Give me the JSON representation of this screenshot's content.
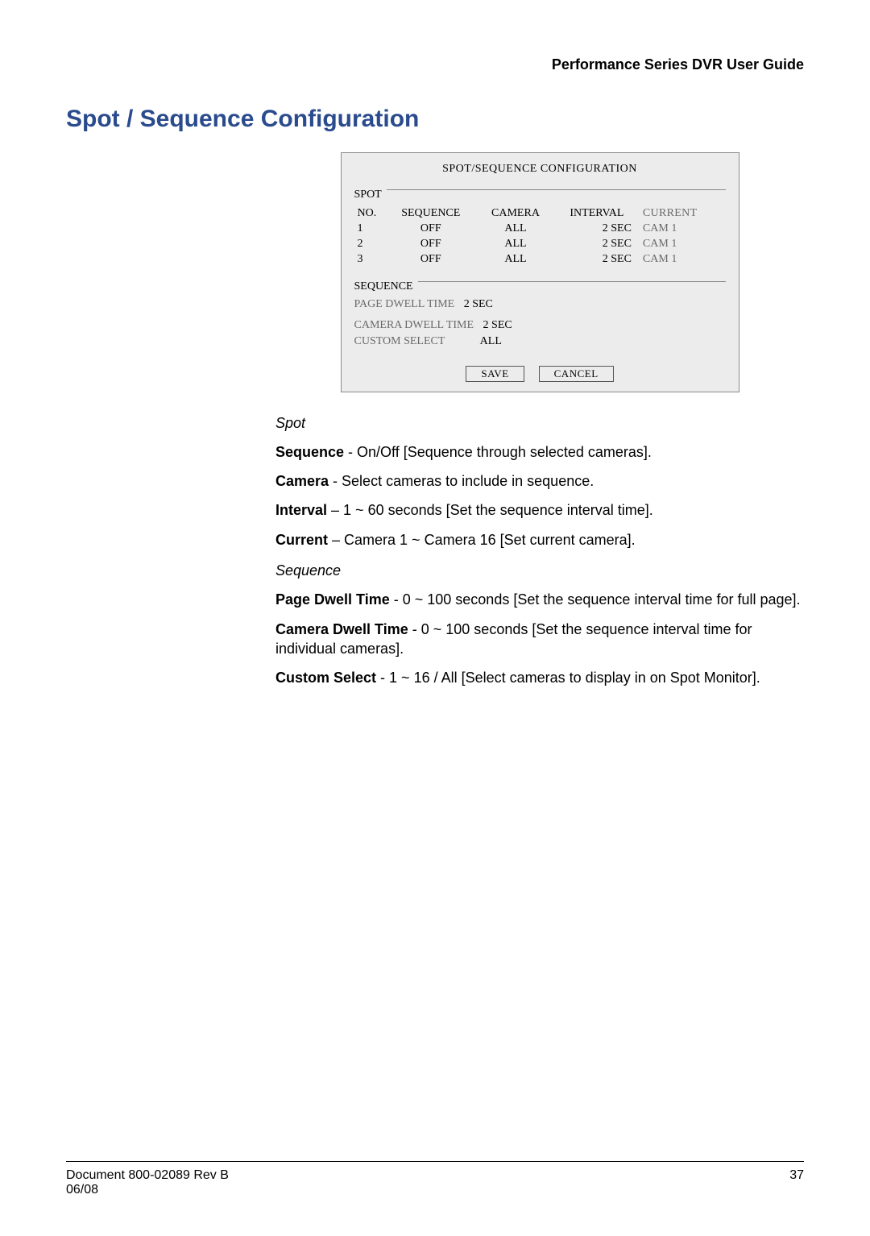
{
  "header": {
    "guide_title": "Performance Series DVR User Guide"
  },
  "section": {
    "heading": "Spot / Sequence Configuration"
  },
  "osd": {
    "title": "SPOT/SEQUENCE CONFIGURATION",
    "spot": {
      "label": "SPOT",
      "headers": {
        "no": "NO.",
        "sequence": "SEQUENCE",
        "camera": "CAMERA",
        "interval": "INTERVAL",
        "current": "CURRENT"
      },
      "rows": [
        {
          "no": "1",
          "sequence": "OFF",
          "camera": "ALL",
          "interval": "2 SEC",
          "current": "CAM 1"
        },
        {
          "no": "2",
          "sequence": "OFF",
          "camera": "ALL",
          "interval": "2 SEC",
          "current": "CAM 1"
        },
        {
          "no": "3",
          "sequence": "OFF",
          "camera": "ALL",
          "interval": "2 SEC",
          "current": "CAM 1"
        }
      ]
    },
    "sequence": {
      "label": "SEQUENCE",
      "page_dwell_label": "PAGE DWELL TIME",
      "page_dwell_value": "2 SEC",
      "camera_dwell_label": "CAMERA DWELL TIME",
      "camera_dwell_value": "2 SEC",
      "custom_select_label": "CUSTOM SELECT",
      "custom_select_value": "ALL"
    },
    "buttons": {
      "save": "SAVE",
      "cancel": "CANCEL"
    }
  },
  "spot_sub": "Spot",
  "spot_items": {
    "sequence": {
      "label": "Sequence",
      "text": " - On/Off [Sequence through selected cameras]."
    },
    "camera": {
      "label": "Camera",
      "text": " - Select cameras to include in sequence."
    },
    "interval": {
      "label": "Interval",
      "text": " – 1 ~ 60 seconds [Set the sequence interval time]."
    },
    "current": {
      "label": "Current",
      "text": " – Camera 1 ~ Camera 16 [Set current camera]."
    }
  },
  "sequence_sub": "Sequence",
  "sequence_items": {
    "page_dwell": {
      "label": "Page Dwell Time",
      "text": " - 0 ~ 100 seconds [Set the sequence interval time for full page]."
    },
    "camera_dwell": {
      "label": "Camera Dwell Time",
      "text": " - 0 ~ 100 seconds [Set the sequence interval time for individual cameras]."
    },
    "custom_select": {
      "label": "Custom Select",
      "text": " - 1 ~ 16 / All [Select cameras to display in on Spot Monitor]."
    }
  },
  "footer": {
    "doc": "Document 800-02089  Rev B",
    "date": "06/08",
    "page": "37"
  }
}
